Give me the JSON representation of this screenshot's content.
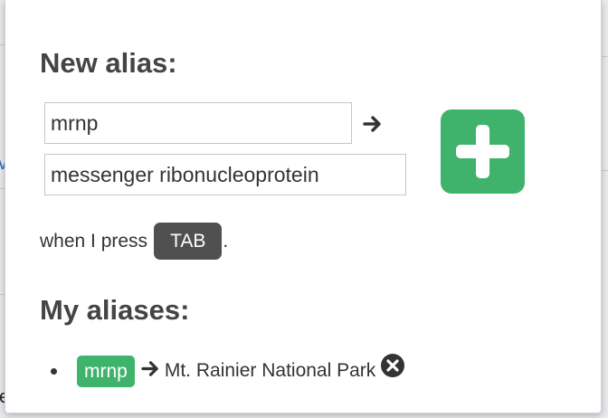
{
  "background": {
    "left_fragment": "v",
    "bottom_fragment": "e"
  },
  "popup": {
    "new_alias": {
      "heading": "New alias:",
      "short_value": "mrnp",
      "expansion_value": "messenger ribonucleoprotein",
      "arrow_icon": "arrow-right-icon",
      "add_icon": "plus-icon",
      "add_color": "#3fb36b"
    },
    "trigger": {
      "prefix": "when I press",
      "key": "TAB",
      "suffix": "."
    },
    "my_aliases": {
      "heading": "My aliases:",
      "items": [
        {
          "key": "mrnp",
          "value": "Mt. Rainier National Park",
          "remove_icon": "remove-circle-icon"
        }
      ]
    }
  }
}
